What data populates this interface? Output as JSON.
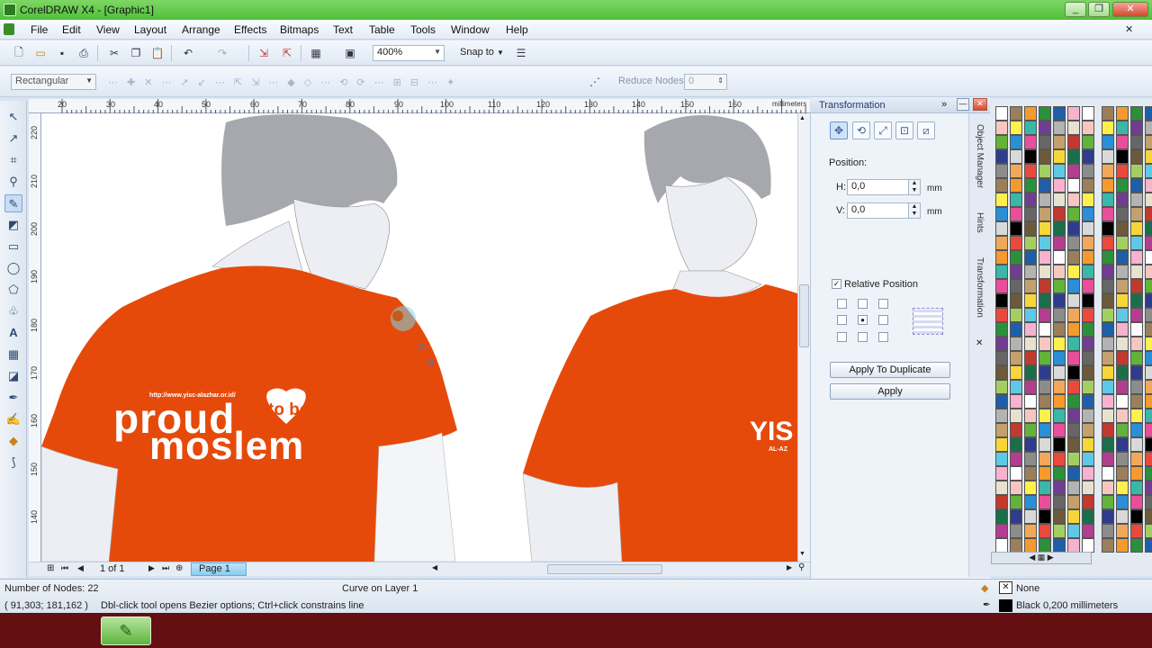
{
  "window": {
    "title": "CorelDRAW X4 - [Graphic1]",
    "controls": [
      "_",
      "❐",
      "✕"
    ]
  },
  "menu": [
    "File",
    "Edit",
    "View",
    "Layout",
    "Arrange",
    "Effects",
    "Bitmaps",
    "Text",
    "Table",
    "Tools",
    "Window",
    "Help"
  ],
  "standard_toolbar": {
    "zoom": "400%",
    "snap_to": "Snap to"
  },
  "property_bar": {
    "selection_mode": "Rectangular",
    "reduce_nodes_label": "Reduce Nodes",
    "reduce_nodes_value": "0"
  },
  "ruler": {
    "unit": "millimeters",
    "h_ticks": [
      "20",
      "30",
      "40",
      "50",
      "60",
      "70",
      "80",
      "90",
      "100",
      "110",
      "120",
      "130",
      "140",
      "150",
      "160"
    ],
    "v_ticks": [
      "220",
      "210",
      "200",
      "190",
      "180",
      "170",
      "160",
      "150",
      "140"
    ]
  },
  "canvas": {
    "tshirt_url": "http://www.yisc-alazhar.or.id/",
    "tshirt_word1": "proud",
    "tshirt_word2": "to be",
    "tshirt_word3": "moslem",
    "tshirt_logo": "YIS",
    "tshirt_logo_sub": "AL-AZ",
    "shirt_color": "#e64a0a",
    "hair_color": "#a6a8ad"
  },
  "page_nav": {
    "page_count": "1 of 1",
    "page_tab": "Page 1"
  },
  "docker": {
    "title": "Transformation",
    "position_label": "Position:",
    "h_label": "H:",
    "h_value": "0,0",
    "v_label": "V:",
    "v_value": "0,0",
    "unit": "mm",
    "relative_position": "Relative Position",
    "apply_duplicate": "Apply To Duplicate",
    "apply": "Apply",
    "side_tabs": [
      "Object Manager",
      "Hints",
      "Transformation"
    ]
  },
  "status": {
    "nodes": "Number of Nodes: 22",
    "layer": "Curve on Layer 1",
    "coords": "( 91,303; 181,162 )",
    "hint": "Dbl-click tool opens Bezier options; Ctrl+click constrains line",
    "fill": "None",
    "outline": "Black  0,200 millimeters"
  },
  "icons": [
    "new-icon",
    "open-icon",
    "save-icon",
    "print-icon",
    "cut-icon",
    "copy-icon",
    "paste-icon",
    "undo-icon",
    "redo-icon",
    "import-icon",
    "export-icon",
    "pick-tool-icon",
    "shape-tool-icon",
    "zoom-tool-icon",
    "fill-icon"
  ]
}
